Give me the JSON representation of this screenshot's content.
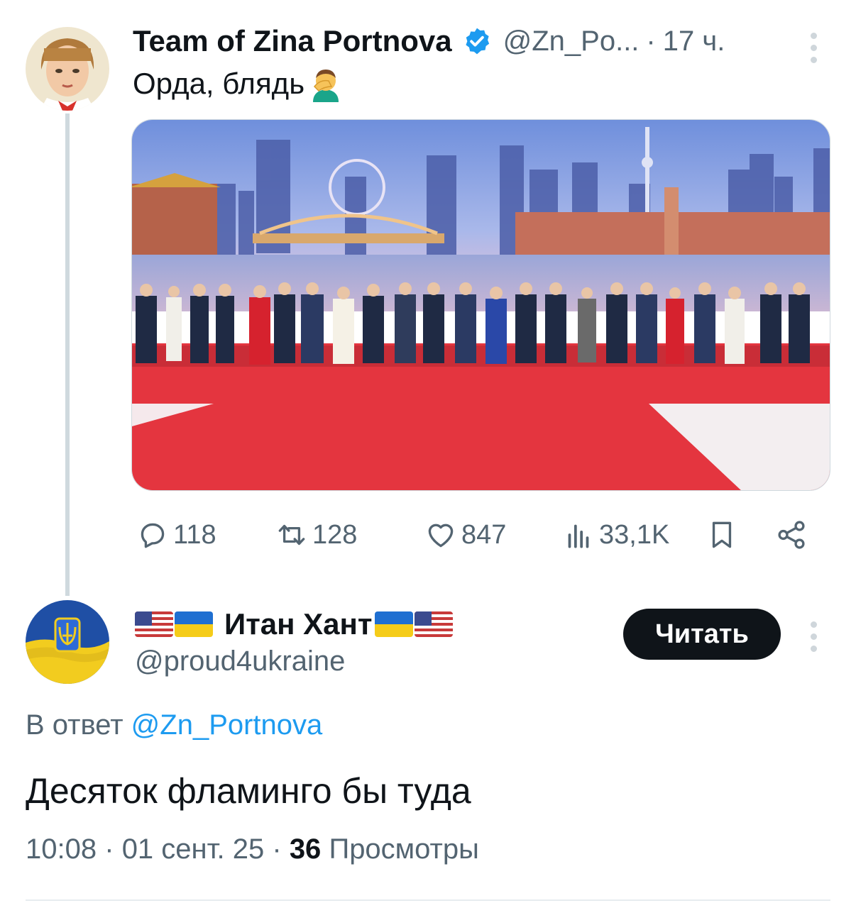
{
  "tweet1": {
    "author_name": "Team of Zina Portnova",
    "handle": "@Zn_Po...",
    "separator": "·",
    "time": "17 ч.",
    "text": "Орда, блядь",
    "emoji_icon": "man-facepalming-emoji",
    "actions": {
      "replies": "118",
      "reposts": "128",
      "likes": "847",
      "views": "33,1K"
    }
  },
  "tweet2": {
    "author_name": "Итан Хант",
    "handle": "@proud4ukraine",
    "follow_label": "Читать",
    "reply_prefix": "В ответ",
    "reply_mention": "@Zn_Portnova",
    "text": "Десяток фламинго бы туда",
    "time": "10:08",
    "separator": "·",
    "date": "01 сент. 25",
    "views_count": "36",
    "views_label": "Просмотры"
  },
  "colors": {
    "accent": "#1d9bf0",
    "text_primary": "#0f1419",
    "text_secondary": "#536471",
    "follow_button_bg": "#0f1419",
    "thread_line": "#cfd9de"
  }
}
